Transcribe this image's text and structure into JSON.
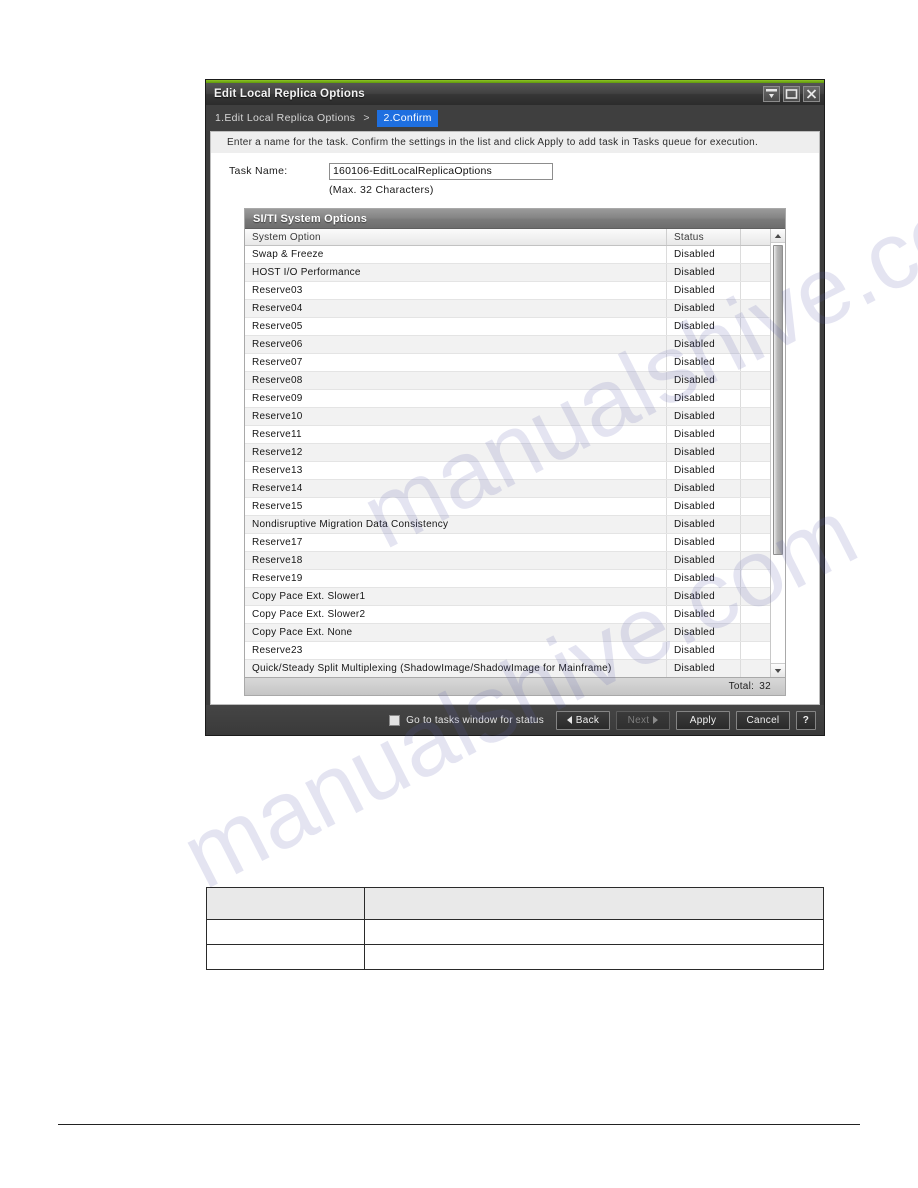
{
  "window": {
    "title": "Edit Local Replica Options",
    "accent_color": "#7ab317",
    "controls": [
      {
        "name": "pin-icon",
        "label": ""
      },
      {
        "name": "maximize-icon",
        "label": ""
      },
      {
        "name": "close-icon",
        "label": ""
      }
    ]
  },
  "breadcrumb": {
    "step1": "1.Edit Local Replica Options",
    "separator": ">",
    "step2": "2.Confirm",
    "active_color": "#1e6fe0"
  },
  "message": "Enter a name for the task. Confirm the settings in the list and click Apply to add task in Tasks queue for execution.",
  "form": {
    "task_name_label": "Task Name:",
    "task_name_value": "160106-EditLocalReplicaOptions",
    "task_name_placeholder": "",
    "max_chars_note": "(Max. 32 Characters)"
  },
  "table": {
    "title": "SI/TI System Options",
    "columns": [
      "System Option",
      "Status",
      ""
    ],
    "rows": [
      {
        "option": "Swap & Freeze",
        "status": "Disabled"
      },
      {
        "option": "HOST I/O Performance",
        "status": "Disabled"
      },
      {
        "option": "Reserve03",
        "status": "Disabled"
      },
      {
        "option": "Reserve04",
        "status": "Disabled"
      },
      {
        "option": "Reserve05",
        "status": "Disabled"
      },
      {
        "option": "Reserve06",
        "status": "Disabled"
      },
      {
        "option": "Reserve07",
        "status": "Disabled"
      },
      {
        "option": "Reserve08",
        "status": "Disabled"
      },
      {
        "option": "Reserve09",
        "status": "Disabled"
      },
      {
        "option": "Reserve10",
        "status": "Disabled"
      },
      {
        "option": "Reserve11",
        "status": "Disabled"
      },
      {
        "option": "Reserve12",
        "status": "Disabled"
      },
      {
        "option": "Reserve13",
        "status": "Disabled"
      },
      {
        "option": "Reserve14",
        "status": "Disabled"
      },
      {
        "option": "Reserve15",
        "status": "Disabled"
      },
      {
        "option": "Nondisruptive Migration Data Consistency",
        "status": "Disabled"
      },
      {
        "option": "Reserve17",
        "status": "Disabled"
      },
      {
        "option": "Reserve18",
        "status": "Disabled"
      },
      {
        "option": "Reserve19",
        "status": "Disabled"
      },
      {
        "option": "Copy Pace Ext. Slower1",
        "status": "Disabled"
      },
      {
        "option": "Copy Pace Ext. Slower2",
        "status": "Disabled"
      },
      {
        "option": "Copy Pace Ext. None",
        "status": "Disabled"
      },
      {
        "option": "Reserve23",
        "status": "Disabled"
      },
      {
        "option": "Quick/Steady Split Multiplexing (ShadowImage/ShadowImage for Mainframe)",
        "status": "Disabled"
      }
    ],
    "total_label": "Total:",
    "total_value": "32"
  },
  "footer": {
    "checkbox_label": "Go to tasks window for status",
    "checkbox_checked": false,
    "back_label": "Back",
    "next_label": "Next",
    "next_disabled": true,
    "apply_label": "Apply",
    "cancel_label": "Cancel",
    "help_label": "?"
  },
  "doc_table": {
    "header": [
      "",
      ""
    ],
    "rows": [
      [
        "",
        ""
      ],
      [
        "",
        ""
      ]
    ]
  },
  "watermark": {
    "line1": "manualshive.com",
    "line2": "manualshive.com"
  }
}
